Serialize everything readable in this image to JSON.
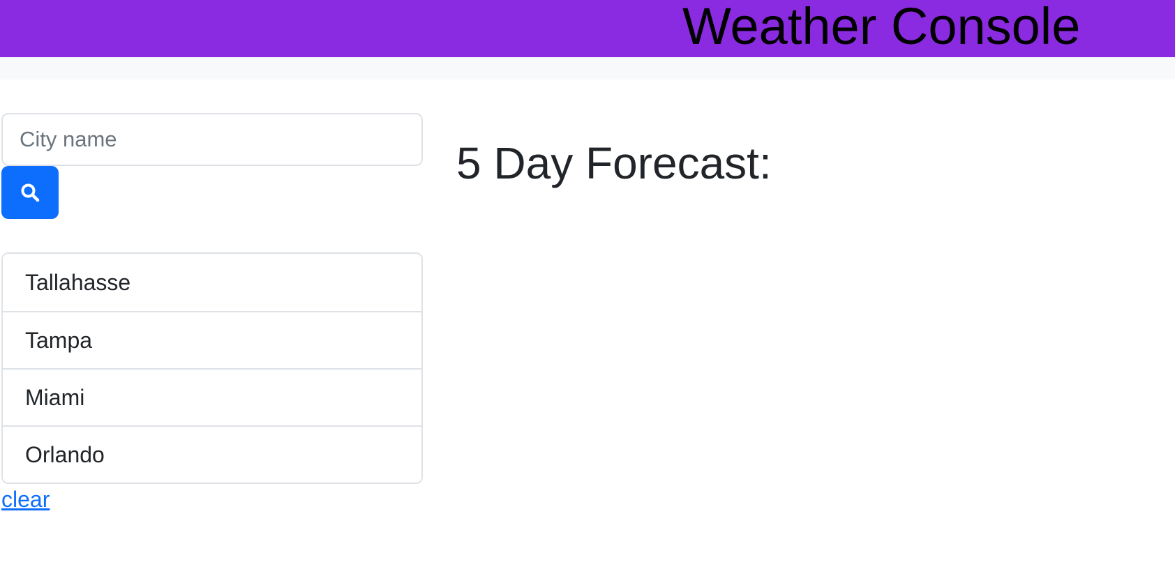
{
  "header": {
    "title": "Weather Console",
    "background_color": "#8a2be2"
  },
  "search": {
    "placeholder": "City name",
    "value": "",
    "button_icon": "search-icon",
    "button_color": "#0d6efd"
  },
  "history": {
    "cities": [
      "Tallahasse",
      "Tampa",
      "Miami",
      "Orlando"
    ],
    "clear_label": "clear"
  },
  "forecast": {
    "title": "5 Day Forecast:"
  }
}
